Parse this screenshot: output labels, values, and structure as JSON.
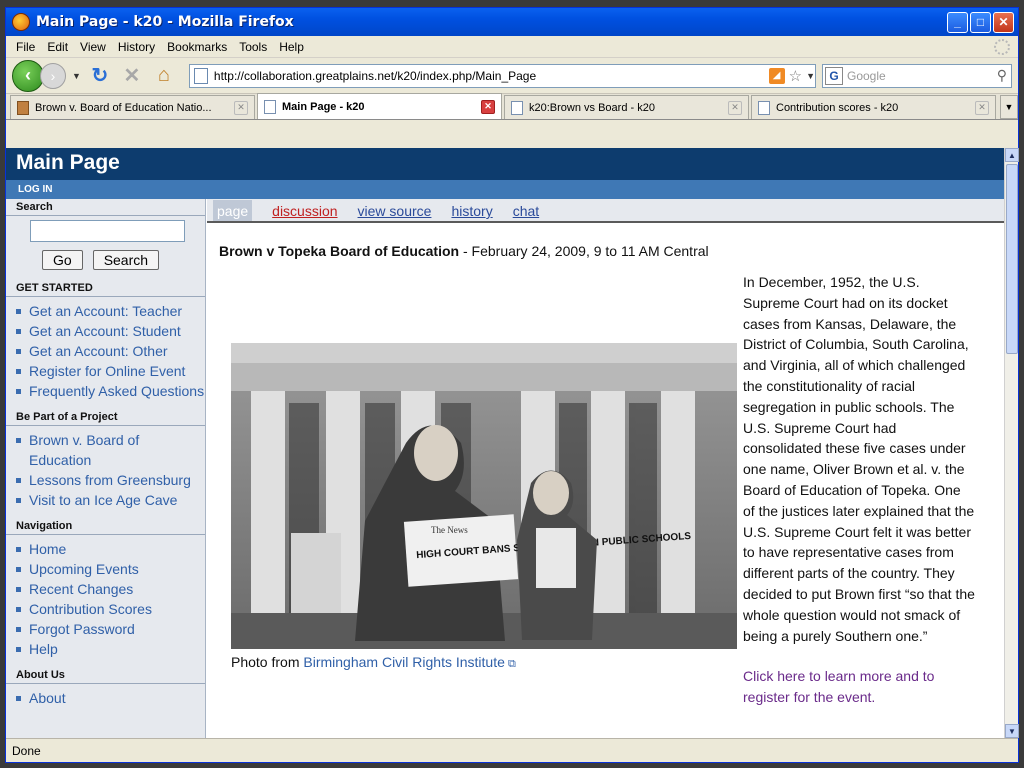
{
  "window": {
    "title": "Main Page - k20 - Mozilla Firefox"
  },
  "menu": [
    "File",
    "Edit",
    "View",
    "History",
    "Bookmarks",
    "Tools",
    "Help"
  ],
  "toolbar": {
    "url": "http://collaboration.greatplains.net/k20/index.php/Main_Page",
    "search_placeholder": "Google"
  },
  "tabs": [
    {
      "label": "Brown v. Board of Education Natio...",
      "active": false
    },
    {
      "label": "Main Page - k20",
      "active": true
    },
    {
      "label": "k20:Brown vs Board - k20",
      "active": false
    },
    {
      "label": "Contribution scores - k20",
      "active": false
    }
  ],
  "wiki": {
    "title": "Main Page",
    "login": "LOG IN"
  },
  "sidebar": {
    "search_heading": "Search",
    "go_label": "Go",
    "search_label": "Search",
    "sections": [
      {
        "heading": "GET STARTED",
        "items": [
          "Get an Account: Teacher",
          "Get an Account: Student",
          "Get an Account: Other",
          "Register for Online Event",
          "Frequently Asked Questions"
        ]
      },
      {
        "heading": "Be Part of a Project",
        "items": [
          "Brown v. Board of Education",
          "Lessons from Greensburg",
          "Visit to an Ice Age Cave"
        ]
      },
      {
        "heading": "Navigation",
        "items": [
          "Home",
          "Upcoming Events",
          "Recent Changes",
          "Contribution Scores",
          "Forgot Password",
          "Help"
        ]
      },
      {
        "heading": "About Us",
        "items": [
          "About"
        ]
      }
    ]
  },
  "page_tabs": [
    "page",
    "discussion",
    "view source",
    "history",
    "chat"
  ],
  "main": {
    "heading_bold": "Brown v Topeka Board of Education",
    "heading_rest": " - February 24, 2009, 9 to 11 AM Central",
    "photo_newspaper": "HIGH COURT BANS SEGREGATION IN PUBLIC SCHOOLS",
    "photo_masthead": "The News",
    "caption_prefix": "Photo from ",
    "caption_link": "Birmingham Civil Rights Institute",
    "article": "In December, 1952, the U.S. Supreme Court had on its docket cases from Kansas, Delaware, the District of Columbia, South Carolina, and Virginia, all of which challenged the constitutionality of racial segregation in public schools. The U.S. Supreme Court had consolidated these five cases under one name, Oliver Brown et al. v. the Board of Education of Topeka. One of the justices later explained that the U.S. Supreme Court felt it was better to have representative cases from different parts of the country. They decided to put Brown first “so that the whole question would not smack of being a purely Southern one.”",
    "event_link": "Click here to learn more and to register for the event."
  },
  "status": "Done"
}
